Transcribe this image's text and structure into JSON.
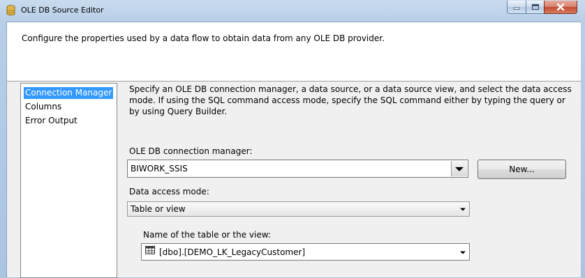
{
  "window": {
    "title": "OLE DB Source Editor"
  },
  "header": {
    "description": "Configure the properties used by a data flow to obtain data from any OLE DB provider."
  },
  "nav": {
    "items": [
      {
        "label": "Connection Manager",
        "selected": true
      },
      {
        "label": "Columns",
        "selected": false
      },
      {
        "label": "Error Output",
        "selected": false
      }
    ]
  },
  "main": {
    "description": "Specify an OLE DB connection manager, a data source, or a data source view, and select the data access mode. If using the SQL command access mode, specify the SQL command either by typing the query or by using Query Builder.",
    "connection_manager": {
      "label": "OLE DB connection manager:",
      "value": "BIWORK_SSIS",
      "new_button": "New..."
    },
    "access_mode": {
      "label": "Data access mode:",
      "value": "Table or view"
    },
    "table": {
      "label": "Name of the table or the view:",
      "value": "[dbo].[DEMO_LK_LegacyCustomer]",
      "icon": "table-icon"
    }
  },
  "colors": {
    "selection": "#3399ff",
    "header_background": "#ffffff",
    "dialog_background": "#f0f0f0"
  }
}
